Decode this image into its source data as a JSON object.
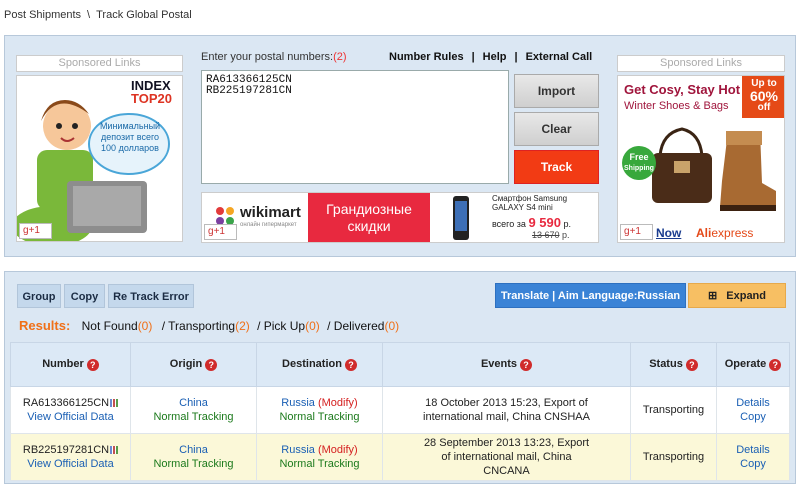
{
  "breadcrumb": {
    "home": "Post Shipments",
    "sep": "\\",
    "current": "Track Global Postal"
  },
  "sponsored_label": "Sponsored Links",
  "entry": {
    "label": "Enter your postal numbers:",
    "count": "(2)",
    "value": "RA613366125CN\nRB225197281CN"
  },
  "top_links": {
    "rules": "Number Rules",
    "help": "Help",
    "external": "External Call",
    "sep": "|"
  },
  "buttons": {
    "import": "Import",
    "clear": "Clear",
    "track": "Track"
  },
  "left_ad": {
    "brand1": "INDEX",
    "brand2": "TOP",
    "brand3": "20",
    "bubble": "Минимальный депозит всего 100 долларов",
    "gplus": "+1"
  },
  "right_ad": {
    "headline1": "Get Cosy, Stay Hot",
    "headline2": "Winter Shoes & Bags",
    "badge_top": "Up to",
    "badge_pct": "60%",
    "badge_off": "off",
    "free1": "Free",
    "free2": "Shipping",
    "now": "Now",
    "brand1": "Ali",
    "brand2": "express",
    "gplus": "+1"
  },
  "mid_ad": {
    "brand": "wikimart",
    "brand_sub": "онлайн гипермаркет",
    "promo": "Грандиозные скидки",
    "phone": "Смартфон Samsung GALAXY S4 mini",
    "price_label": "всего за",
    "price": "9 590",
    "cur": "р.",
    "old_price": "13 670",
    "old_cur": "р.",
    "gplus": "+1"
  },
  "toolbar": {
    "group": "Group",
    "copy": "Copy",
    "retrack": "Re Track Error",
    "translate": "Translate | Aim Language:Russian",
    "expand": "Expand",
    "expand_icon": "⊞"
  },
  "summary": {
    "label": "Results:",
    "not_found": "Not Found",
    "not_found_n": "(0)",
    "transporting": "/ Transporting",
    "transporting_n": "(2)",
    "pickup": "/ Pick Up",
    "pickup_n": "(0)",
    "delivered": "/ Delivered",
    "delivered_n": "(0)"
  },
  "table": {
    "headers": [
      "Number",
      "Origin",
      "Destination",
      "Events",
      "Status",
      "Operate"
    ],
    "q_icon": "?",
    "rows": [
      {
        "number": "RA613366125CN",
        "official": "View Official Data",
        "origin": "China",
        "origin_track": "Normal Tracking",
        "dest": "Russia",
        "modify": "(Modify)",
        "dest_track": "Normal Tracking",
        "event": "18 October 2013 15:23, Export of international mail, China CNSHAA",
        "status": "Transporting",
        "details": "Details",
        "copy": "Copy"
      },
      {
        "number": "RB225197281CN",
        "official": "View Official Data",
        "origin": "China",
        "origin_track": "Normal Tracking",
        "dest": "Russia",
        "modify": "(Modify)",
        "dest_track": "Normal Tracking",
        "event": "28 September 2013 13:23, Export of international mail, China CNCANA",
        "status": "Transporting",
        "details": "Details",
        "copy": "Copy"
      }
    ]
  },
  "colors": {
    "track": "#f23b14",
    "translate": "#3a83d6",
    "expand": "#f7bf63",
    "accent_orange": "#f07018"
  }
}
